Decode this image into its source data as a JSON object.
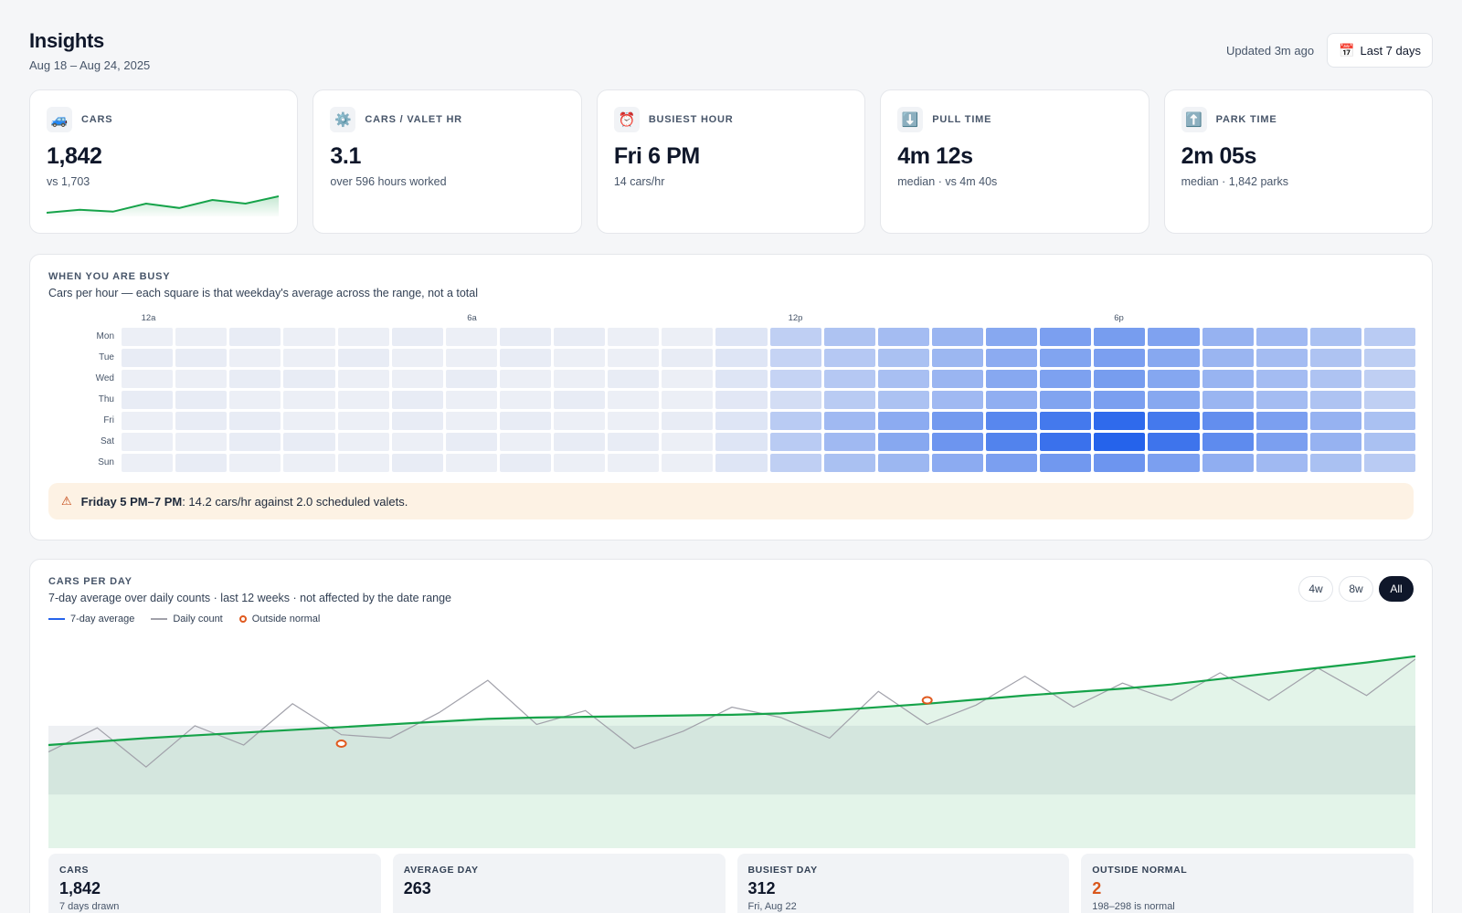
{
  "header": {
    "title": "Insights",
    "date_range": "Aug 18 – Aug 24, 2025",
    "updated": "Updated 3m ago",
    "range_button_icon": "📅",
    "range_button": "Last 7 days"
  },
  "kpis": [
    {
      "icon": "🚙",
      "label": "CARS",
      "value": "1,842",
      "sub": "vs 1,703"
    },
    {
      "icon": "⚙️",
      "label": "CARS / VALET HR",
      "value": "3.1",
      "sub": "over 596 hours worked"
    },
    {
      "icon": "⏰",
      "label": "BUSIEST HOUR",
      "value": "Fri 6 PM",
      "sub": "14 cars/hr"
    },
    {
      "icon": "⬇️",
      "label": "PULL TIME",
      "value": "4m 12s",
      "sub": "median · vs 4m 40s"
    },
    {
      "icon": "⬆️",
      "label": "PARK TIME",
      "value": "2m 05s",
      "sub": "median · 1,842 parks"
    }
  ],
  "kpi_sparkline": [
    255,
    263,
    258,
    280,
    268,
    290,
    280,
    300
  ],
  "busy": {
    "title": "WHEN YOU ARE BUSY",
    "subtitle": "Cars per hour — each square is that weekday's average across the range, not a total",
    "hour_labels": [
      {
        "hour": 0,
        "label": "12a"
      },
      {
        "hour": 6,
        "label": "6a"
      },
      {
        "hour": 12,
        "label": "12p"
      },
      {
        "hour": 18,
        "label": "6p"
      }
    ],
    "days": [
      "Mon",
      "Tue",
      "Wed",
      "Thu",
      "Fri",
      "Sat",
      "Sun"
    ],
    "intensity": [
      [
        0.03,
        0.03,
        0.05,
        0.03,
        0.03,
        0.05,
        0.03,
        0.05,
        0.05,
        0.03,
        0.03,
        0.1,
        0.25,
        0.33,
        0.38,
        0.43,
        0.52,
        0.58,
        0.6,
        0.56,
        0.45,
        0.4,
        0.35,
        0.28
      ],
      [
        0.05,
        0.05,
        0.03,
        0.03,
        0.05,
        0.03,
        0.03,
        0.05,
        0.03,
        0.03,
        0.05,
        0.1,
        0.22,
        0.3,
        0.35,
        0.42,
        0.5,
        0.55,
        0.58,
        0.52,
        0.43,
        0.38,
        0.33,
        0.26
      ],
      [
        0.03,
        0.03,
        0.05,
        0.05,
        0.03,
        0.03,
        0.05,
        0.03,
        0.03,
        0.05,
        0.03,
        0.1,
        0.22,
        0.3,
        0.36,
        0.43,
        0.52,
        0.57,
        0.6,
        0.53,
        0.44,
        0.38,
        0.33,
        0.25
      ],
      [
        0.05,
        0.05,
        0.03,
        0.03,
        0.03,
        0.05,
        0.03,
        0.03,
        0.05,
        0.03,
        0.03,
        0.08,
        0.15,
        0.28,
        0.34,
        0.4,
        0.48,
        0.55,
        0.58,
        0.52,
        0.43,
        0.38,
        0.33,
        0.25
      ],
      [
        0.03,
        0.05,
        0.05,
        0.03,
        0.03,
        0.05,
        0.03,
        0.05,
        0.03,
        0.03,
        0.05,
        0.1,
        0.28,
        0.4,
        0.5,
        0.62,
        0.75,
        0.85,
        0.95,
        0.85,
        0.7,
        0.58,
        0.45,
        0.35
      ],
      [
        0.03,
        0.03,
        0.05,
        0.05,
        0.03,
        0.03,
        0.05,
        0.03,
        0.05,
        0.05,
        0.03,
        0.1,
        0.28,
        0.4,
        0.52,
        0.65,
        0.78,
        0.9,
        1.0,
        0.88,
        0.72,
        0.58,
        0.45,
        0.35
      ],
      [
        0.03,
        0.05,
        0.03,
        0.03,
        0.03,
        0.05,
        0.03,
        0.05,
        0.03,
        0.03,
        0.03,
        0.1,
        0.25,
        0.35,
        0.42,
        0.5,
        0.58,
        0.63,
        0.65,
        0.58,
        0.48,
        0.4,
        0.35,
        0.28
      ]
    ],
    "alert_bold": "Friday 5 PM–7 PM",
    "alert_text": ": 14.2 cars/hr against 2.0 scheduled valets."
  },
  "cars_per_day": {
    "title": "CARS PER DAY",
    "subtitle": "7-day average over daily counts · last 12 weeks · not affected by the date range",
    "toggle": [
      "4w",
      "8w",
      "All"
    ],
    "active_toggle": "All",
    "legend": [
      "7-day average",
      "Daily count",
      "Outside normal"
    ],
    "colors": {
      "average": "#16a34a",
      "daily": "#a1a1aa",
      "outside": "#e05a1f",
      "legend_avg": "#2563eb"
    }
  },
  "chart_data": {
    "type": "line",
    "x_count": 26,
    "normal_band": [
      198,
      298
    ],
    "ylim": [
      120,
      420
    ],
    "series": [
      {
        "name": "7-day average",
        "values": [
          270,
          275,
          280,
          284,
          288,
          292,
          296,
          300,
          304,
          308,
          310,
          311,
          312,
          313,
          314,
          316,
          320,
          325,
          330,
          336,
          342,
          347,
          352,
          358,
          366,
          374,
          382,
          390,
          399
        ]
      },
      {
        "name": "Daily count",
        "values": [
          260,
          295,
          238,
          298,
          270,
          330,
          285,
          280,
          317,
          364,
          300,
          320,
          265,
          290,
          325,
          310,
          280,
          348,
          300,
          328,
          370,
          325,
          360,
          335,
          375,
          335,
          382,
          342,
          395
        ]
      }
    ],
    "outside_points": [
      {
        "index": 6,
        "value": 272
      },
      {
        "index": 18,
        "value": 335
      }
    ]
  },
  "stats": [
    {
      "label": "CARS",
      "value": "1,842",
      "sub": "7 days drawn"
    },
    {
      "label": "AVERAGE DAY",
      "value": "263",
      "sub": ""
    },
    {
      "label": "BUSIEST DAY",
      "value": "312",
      "sub": "Fri, Aug 22"
    },
    {
      "label": "OUTSIDE NORMAL",
      "value": "2",
      "sub": "198–298 is normal"
    }
  ]
}
